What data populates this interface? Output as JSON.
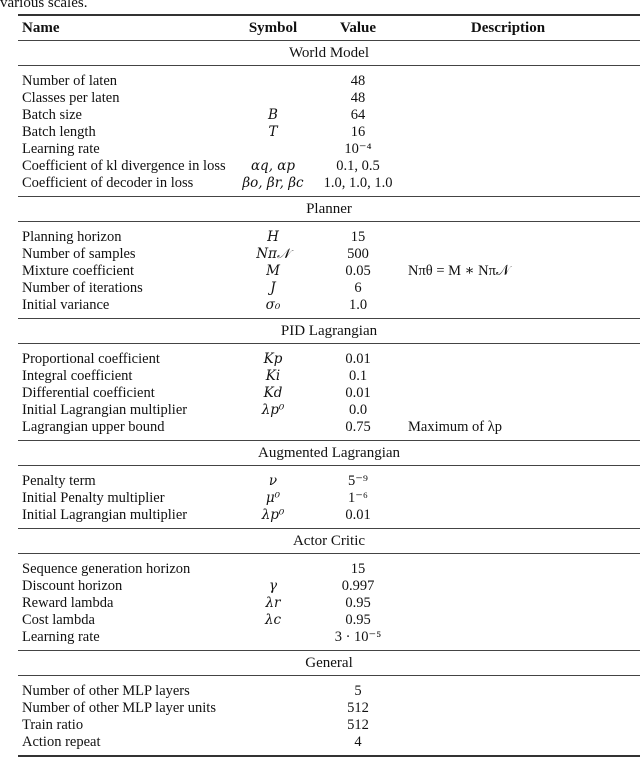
{
  "caption_fragment": "various scales.",
  "header": {
    "name": "Name",
    "symbol": "Symbol",
    "value": "Value",
    "description": "Description"
  },
  "sections": [
    {
      "title": "World Model",
      "rows": [
        {
          "name": "Number of laten",
          "symbol": "",
          "value": "48",
          "description": ""
        },
        {
          "name": "Classes per laten",
          "symbol": "",
          "value": "48",
          "description": ""
        },
        {
          "name": "Batch size",
          "symbol": "B",
          "value": "64",
          "description": ""
        },
        {
          "name": "Batch length",
          "symbol": "T",
          "value": "16",
          "description": ""
        },
        {
          "name": "Learning rate",
          "symbol": "",
          "value": "10⁻⁴",
          "description": ""
        },
        {
          "name": "Coefficient of kl divergence in loss",
          "symbol": "αq, αp",
          "value": "0.1, 0.5",
          "description": ""
        },
        {
          "name": "Coefficient of decoder in loss",
          "symbol": "βo, βr, βc",
          "value": "1.0, 1.0, 1.0",
          "description": ""
        }
      ]
    },
    {
      "title": "Planner",
      "rows": [
        {
          "name": "Planning horizon",
          "symbol": "H",
          "value": "15",
          "description": ""
        },
        {
          "name": "Number of samples",
          "symbol": "Nπ𝒩",
          "value": "500",
          "description": ""
        },
        {
          "name": "Mixture coefficient",
          "symbol": "M",
          "value": "0.05",
          "description": "Nπθ = M ∗ Nπ𝒩"
        },
        {
          "name": "Number of iterations",
          "symbol": "J",
          "value": "6",
          "description": ""
        },
        {
          "name": "Initial variance",
          "symbol": "σ₀",
          "value": "1.0",
          "description": ""
        }
      ]
    },
    {
      "title": "PID Lagrangian",
      "rows": [
        {
          "name": "Proportional coefficient",
          "symbol": "Kp",
          "value": "0.01",
          "description": ""
        },
        {
          "name": "Integral coefficient",
          "symbol": "Ki",
          "value": "0.1",
          "description": ""
        },
        {
          "name": "Differential coefficient",
          "symbol": "Kd",
          "value": "0.01",
          "description": ""
        },
        {
          "name": "Initial Lagrangian multiplier",
          "symbol": "λp⁰",
          "value": "0.0",
          "description": ""
        },
        {
          "name": "Lagrangian upper bound",
          "symbol": "",
          "value": "0.75",
          "description": "Maximum of λp"
        }
      ]
    },
    {
      "title": "Augmented Lagrangian",
      "rows": [
        {
          "name": "Penalty term",
          "symbol": "ν",
          "value": "5⁻⁹",
          "description": ""
        },
        {
          "name": "Initial Penalty multiplier",
          "symbol": "μ⁰",
          "value": "1⁻⁶",
          "description": ""
        },
        {
          "name": "Initial Lagrangian multiplier",
          "symbol": "λp⁰",
          "value": "0.01",
          "description": ""
        }
      ]
    },
    {
      "title": "Actor Critic",
      "rows": [
        {
          "name": "Sequence generation horizon",
          "symbol": "",
          "value": "15",
          "description": ""
        },
        {
          "name": "Discount horizon",
          "symbol": "γ",
          "value": "0.997",
          "description": ""
        },
        {
          "name": "Reward lambda",
          "symbol": "λr",
          "value": "0.95",
          "description": ""
        },
        {
          "name": "Cost lambda",
          "symbol": "λc",
          "value": "0.95",
          "description": ""
        },
        {
          "name": "Learning rate",
          "symbol": "",
          "value": "3 · 10⁻⁵",
          "description": ""
        }
      ]
    },
    {
      "title": "General",
      "rows": [
        {
          "name": "Number of other MLP layers",
          "symbol": "",
          "value": "5",
          "description": ""
        },
        {
          "name": "Number of other MLP layer units",
          "symbol": "",
          "value": "512",
          "description": ""
        },
        {
          "name": "Train ratio",
          "symbol": "",
          "value": "512",
          "description": ""
        },
        {
          "name": "Action repeat",
          "symbol": "",
          "value": "4",
          "description": ""
        }
      ]
    }
  ]
}
